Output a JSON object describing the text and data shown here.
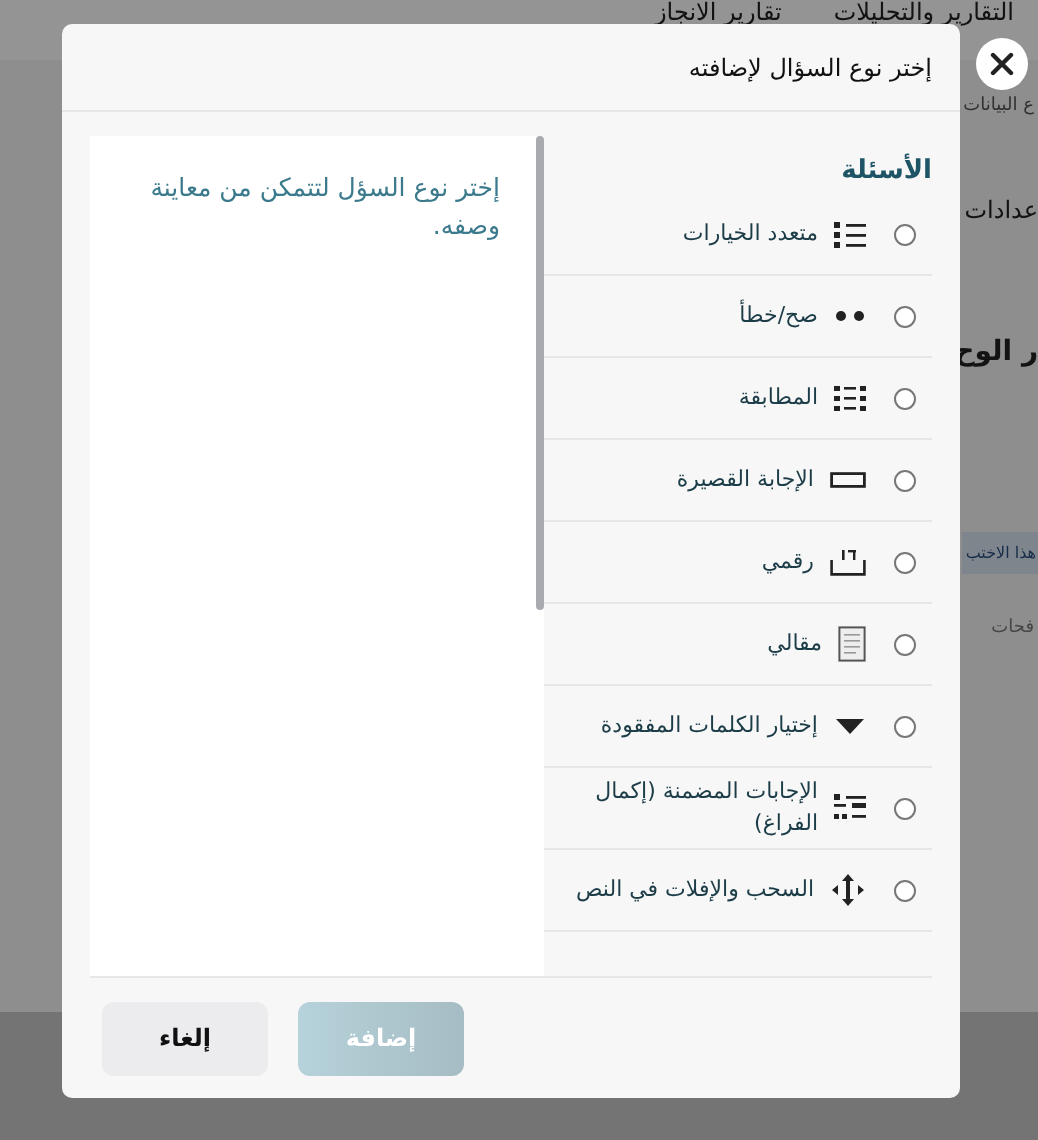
{
  "background_page": {
    "nav_items": [
      "التقارير والتحليلات",
      "تقارير الانجاز"
    ],
    "texts": [
      {
        "kind": "tab",
        "text": "ع البيانات"
      },
      {
        "kind": "heading",
        "text": "عدادات"
      },
      {
        "kind": "title",
        "text": "ر الوح"
      },
      {
        "kind": "banner",
        "text": "هذا الاختب"
      },
      {
        "kind": "tab",
        "text": "فحات"
      }
    ]
  },
  "dialog": {
    "title": "إختر نوع السؤال لإضافته",
    "preview": {
      "text": "إختر نوع السؤل لتتمكن من معاينة وصفه."
    },
    "question_types": {
      "heading": "الأسئلة",
      "items": [
        {
          "label": "متعدد الخيارات",
          "kind": "list",
          "selected": false
        },
        {
          "label": "صح/خطأ",
          "kind": "dots",
          "selected": false
        },
        {
          "label": "المطابقة",
          "kind": "matching",
          "selected": false
        },
        {
          "label": "الإجابة القصيرة",
          "kind": "field",
          "selected": false
        },
        {
          "label": "رقمي",
          "kind": "numeric",
          "selected": false
        },
        {
          "label": "مقالي",
          "kind": "essay",
          "selected": false
        },
        {
          "label": "إختيار الكلمات المفقودة",
          "kind": "dropdown",
          "selected": false
        },
        {
          "label": "الإجابات المضمنة (إكمال الفراغ)",
          "kind": "embedded",
          "selected": false
        },
        {
          "label": "السحب والإفلات في النص",
          "kind": "move",
          "selected": false
        }
      ]
    },
    "buttons": [
      {
        "label": "إضافة",
        "kind": "primary",
        "disabled": true
      },
      {
        "label": "إلغاء",
        "kind": "cancel",
        "disabled": false
      }
    ]
  }
}
